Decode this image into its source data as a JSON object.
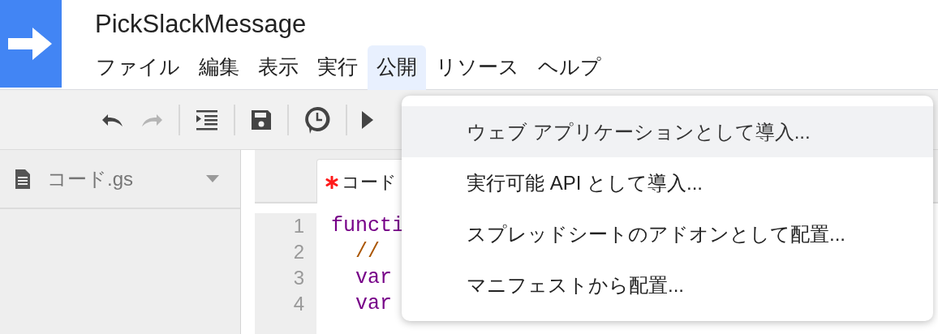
{
  "app": {
    "title": "PickSlackMessage"
  },
  "menubar": [
    {
      "label": "ファイル",
      "selected": false
    },
    {
      "label": "編集",
      "selected": false
    },
    {
      "label": "表示",
      "selected": false
    },
    {
      "label": "実行",
      "selected": false
    },
    {
      "label": "公開",
      "selected": true
    },
    {
      "label": "リソース",
      "selected": false
    },
    {
      "label": "ヘルプ",
      "selected": false
    }
  ],
  "toolbar": [
    {
      "kind": "undo",
      "disabled": false
    },
    {
      "kind": "redo",
      "disabled": true
    },
    {
      "kind": "separator"
    },
    {
      "kind": "indent",
      "disabled": false
    },
    {
      "kind": "separator"
    },
    {
      "kind": "save",
      "disabled": false
    },
    {
      "kind": "separator"
    },
    {
      "kind": "trigger",
      "disabled": false
    },
    {
      "kind": "separator"
    },
    {
      "kind": "run",
      "disabled": false
    }
  ],
  "sidebar": {
    "files": [
      {
        "name": "コード.gs"
      }
    ]
  },
  "editor": {
    "tab": {
      "label": "コード",
      "modified": true
    },
    "lines": [
      {
        "number": "1",
        "tokens": [
          {
            "kind": "keyword",
            "text": "functi"
          }
        ]
      },
      {
        "number": "2",
        "tokens": [
          {
            "kind": "comment",
            "text": "  //"
          }
        ]
      },
      {
        "number": "3",
        "tokens": [
          {
            "kind": "keyword",
            "text": "  var"
          }
        ]
      },
      {
        "number": "4",
        "tokens": [
          {
            "kind": "keyword",
            "text": "  var"
          }
        ]
      }
    ]
  },
  "dropdown": {
    "items": [
      {
        "label": "ウェブ アプリケーションとして導入...",
        "selected": true
      },
      {
        "label": "実行可能 API として導入...",
        "selected": false
      },
      {
        "label": "スプレッドシートのアドオンとして配置...",
        "selected": false
      },
      {
        "label": "マニフェストから配置...",
        "selected": false
      }
    ]
  }
}
